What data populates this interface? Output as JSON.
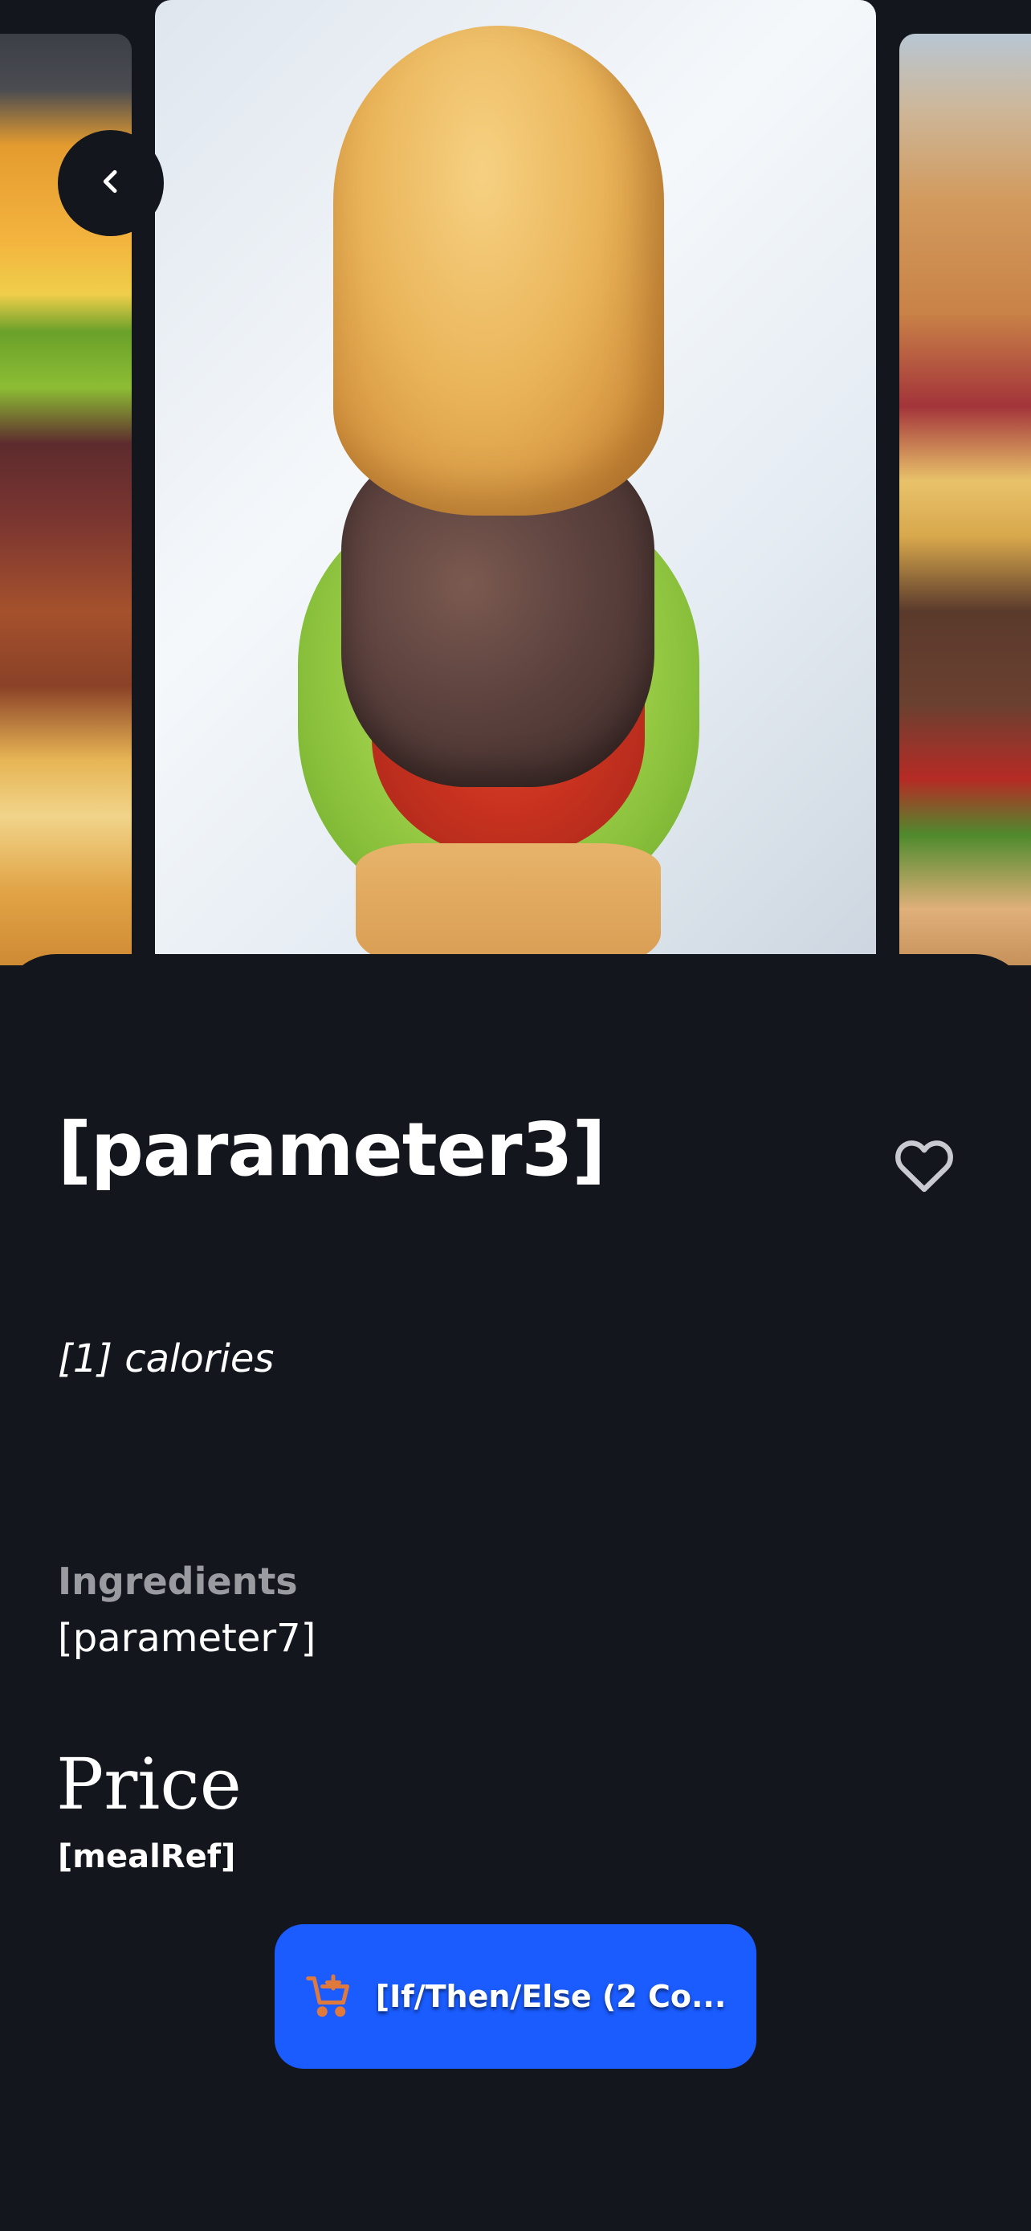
{
  "carousel": {
    "slides": [
      "burger-left",
      "burger-center",
      "burger-right"
    ]
  },
  "header": {
    "back_icon": "chevron-left-icon"
  },
  "meal": {
    "name": "[parameter3]",
    "calories_text": "[1] calories",
    "favorite_icon": "heart-outline-icon"
  },
  "ingredients": {
    "heading": "Ingredients",
    "value": "[parameter7]"
  },
  "price": {
    "heading": "Price",
    "value": "[mealRef]"
  },
  "cart_button": {
    "icon": "cart-add-icon",
    "label": "[If/Then/Else (2 Co..."
  },
  "colors": {
    "background": "#14161d",
    "accent": "#1a5cff",
    "cart_icon": "#e07a3c",
    "muted_text": "#9a9ba1"
  }
}
